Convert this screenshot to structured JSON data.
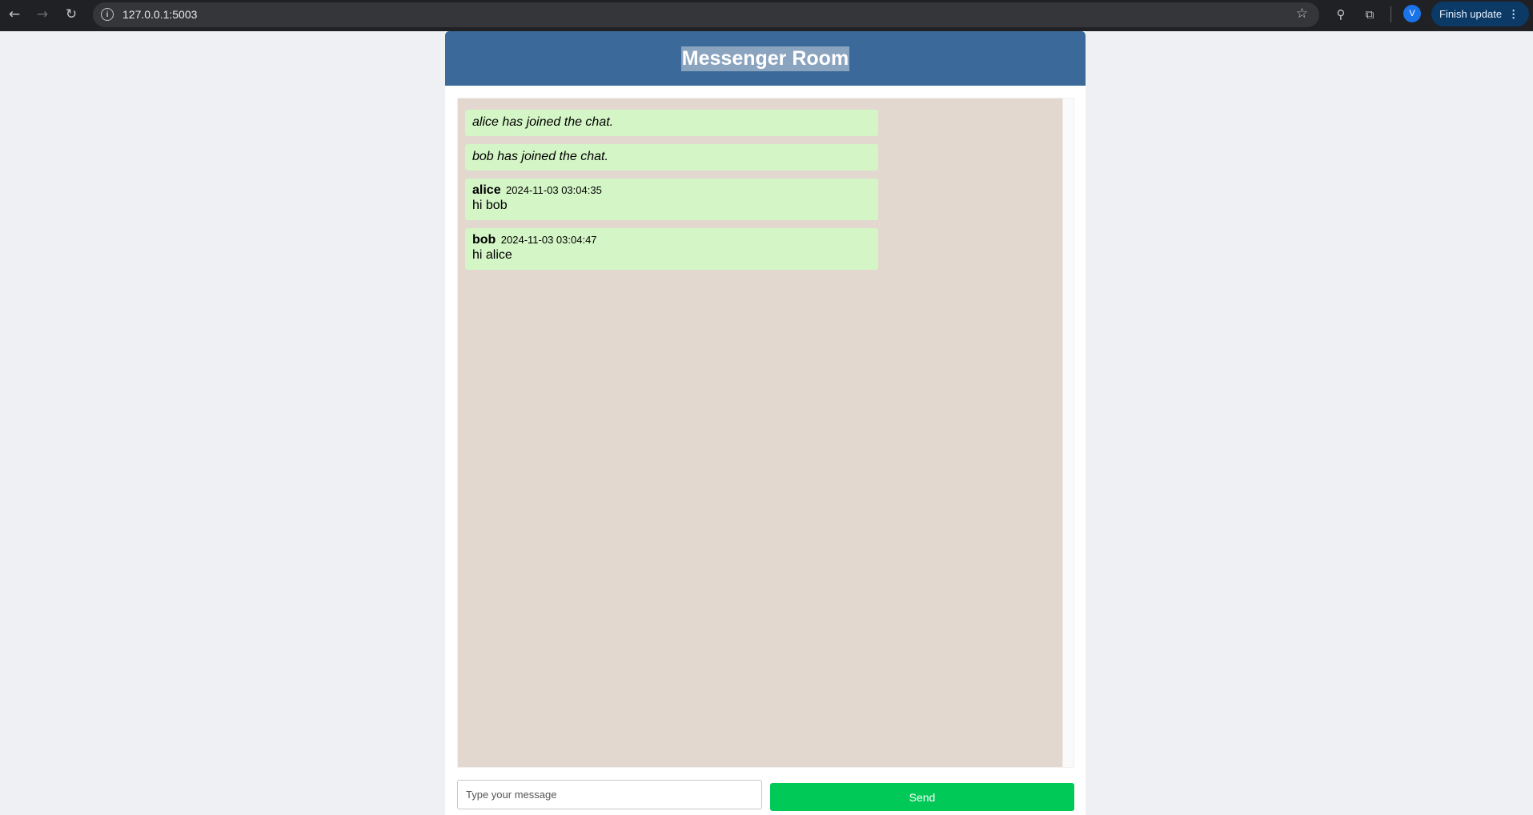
{
  "browser": {
    "back_icon": "←",
    "forward_icon": "→",
    "reload_icon": "↻",
    "site_info_icon": "i",
    "url": "127.0.0.1:5003",
    "star_icon": "☆",
    "extension_icon_1": "⚲",
    "extension_icon_2": "⧉",
    "profile_initial": "V",
    "finish_update_label": "Finish update",
    "menu_icon": "⋮"
  },
  "app": {
    "title": "Messenger Room",
    "messages": [
      {
        "type": "system",
        "text": "alice has joined the chat."
      },
      {
        "type": "system",
        "text": "bob has joined the chat."
      },
      {
        "type": "user",
        "sender": "alice",
        "time": "2024-11-03 03:04:35",
        "text": "hi bob"
      },
      {
        "type": "user",
        "sender": "bob",
        "time": "2024-11-03 03:04:47",
        "text": "hi alice"
      }
    ],
    "composer": {
      "placeholder": "Type your message",
      "value": "",
      "send_label": "Send"
    }
  },
  "colors": {
    "header": "#3b6a9a",
    "chat_background": "#e2d8cf",
    "bubble": "#d4f5c6",
    "send_button": "#00c957"
  }
}
